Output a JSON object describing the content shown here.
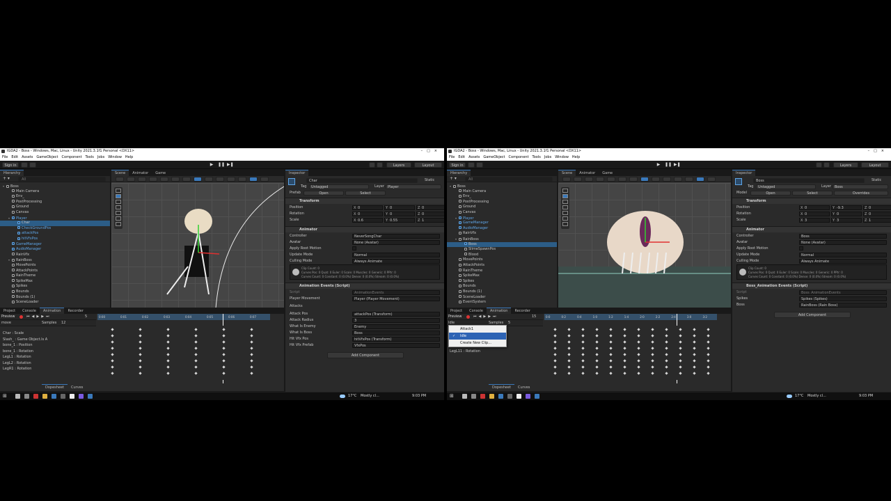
{
  "screens": [
    {
      "window_title": "IGDA2 - Boss - Windows, Mac, Linux - Unity 2021.3.1f1 Personal <DX11>",
      "menu": [
        "File",
        "Edit",
        "Assets",
        "GameObject",
        "Component",
        "Tools",
        "Jobs",
        "Window",
        "Help"
      ],
      "sign_in": "Sign in",
      "layers_label": "Layers",
      "layout_label": "Layout",
      "hierarchy": {
        "tab": "Hierarchy",
        "search_placeholder": "All",
        "items": [
          {
            "label": "Boss",
            "indent": 0,
            "selected": false,
            "blue": false
          },
          {
            "label": "Main Camera",
            "indent": 1,
            "selected": false,
            "blue": false
          },
          {
            "label": "Env_",
            "indent": 1,
            "selected": false,
            "blue": false
          },
          {
            "label": "PostProcessing",
            "indent": 1,
            "selected": false,
            "blue": false
          },
          {
            "label": "Ground",
            "indent": 1,
            "selected": false,
            "blue": false
          },
          {
            "label": "Canvas",
            "indent": 1,
            "selected": false,
            "blue": false
          },
          {
            "label": "Player",
            "indent": 1,
            "selected": false,
            "blue": true
          },
          {
            "label": "Char",
            "indent": 2,
            "selected": true,
            "blue": true
          },
          {
            "label": "CheckGroundPos",
            "indent": 2,
            "selected": false,
            "blue": true
          },
          {
            "label": "attackPos",
            "indent": 2,
            "selected": false,
            "blue": true
          },
          {
            "label": "hitVfxPos",
            "indent": 2,
            "selected": false,
            "blue": true
          },
          {
            "label": "GameManager",
            "indent": 1,
            "selected": false,
            "blue": true
          },
          {
            "label": "AudioManager",
            "indent": 1,
            "selected": false,
            "blue": true
          },
          {
            "label": "RainVfx",
            "indent": 1,
            "selected": false,
            "blue": false
          },
          {
            "label": "RainBoss",
            "indent": 1,
            "selected": false,
            "blue": false
          },
          {
            "label": "MovePoints",
            "indent": 1,
            "selected": false,
            "blue": false
          },
          {
            "label": "AttackPoints",
            "indent": 1,
            "selected": false,
            "blue": false
          },
          {
            "label": "RainTheme",
            "indent": 1,
            "selected": false,
            "blue": false
          },
          {
            "label": "SpikeMax",
            "indent": 1,
            "selected": false,
            "blue": false
          },
          {
            "label": "Spikes",
            "indent": 1,
            "selected": false,
            "blue": false
          },
          {
            "label": "Bounds",
            "indent": 1,
            "selected": false,
            "blue": false
          },
          {
            "label": "Bounds (1)",
            "indent": 1,
            "selected": false,
            "blue": false
          },
          {
            "label": "SceneLoader",
            "indent": 1,
            "selected": false,
            "blue": false
          }
        ]
      },
      "scene_tabs": [
        "Scene",
        "Animator",
        "Game"
      ],
      "inspector": {
        "tab": "Inspector",
        "object_name": "Char",
        "static_label": "Static",
        "tag_label": "Tag",
        "tag_value": "Untagged",
        "layer_label": "Layer",
        "layer_value": "Player",
        "prefab_label": "Prefab",
        "prefab_open": "Open",
        "prefab_select": "Select",
        "prefab_overrides": "",
        "transform_title": "Transform",
        "position_label": "Position",
        "rotation_label": "Rotation",
        "scale_label": "Scale",
        "position": [
          "0",
          "0",
          "0"
        ],
        "rotation": [
          "0",
          "0",
          "0"
        ],
        "scale": [
          "0.6",
          "0.55",
          "1"
        ],
        "animator_title": "Animator",
        "controller_label": "Controller",
        "controller_value": "NeverSongChar",
        "avatar_label": "Avatar",
        "avatar_value": "None (Avatar)",
        "apply_root_label": "Apply Root Motion",
        "update_mode_label": "Update Mode",
        "update_mode_value": "Normal",
        "culling_label": "Culling Mode",
        "culling_value": "Always Animate",
        "info_1": "Clip Count: 0",
        "info_2": "Curves Pos: 0 Quat: 0 Euler: 0 Scale: 0 Muscles: 0 Generic: 0 PPtr: 0",
        "info_3": "Curves Count: 0 Constant: 0 (0.0%) Dense: 0 (0.0%) Stream: 0 (0.0%)",
        "script_title": "Animation Events (Script)",
        "script_fields": [
          {
            "label": "Script",
            "value": "AnimationEvents"
          },
          {
            "label": "Player Movement",
            "value": "Player (Player Movement)"
          },
          {
            "label": "Attacks",
            "value": ""
          },
          {
            "label": "Attack Pos",
            "value": "attackPos (Transform)"
          },
          {
            "label": "Attack Radius",
            "value": "3"
          },
          {
            "label": "What Is Enemy",
            "value": "Enemy"
          },
          {
            "label": "What Is Boss",
            "value": "Boss"
          },
          {
            "label": "Hit Vfx Pos",
            "value": "hitVfxPos (Transform)"
          },
          {
            "label": "Hit Vfx Prefab",
            "value": "VfxPos"
          }
        ],
        "add_component": "Add Component"
      },
      "animation": {
        "tabs": [
          "Project",
          "Console",
          "Animation",
          "Recorder"
        ],
        "preview_label": "Preview",
        "frame_value": "5",
        "clip_name": "move",
        "samples_label": "Samples",
        "samples_value": "12",
        "ruler": [
          "0:00",
          "0:01",
          "0:02",
          "0:03",
          "0:04",
          "0:05",
          "0:06",
          "0:07"
        ],
        "properties": [
          "Char : Scale",
          "Slash_ : Game Object.Is A",
          "bone_1 : Position",
          "bone_1 : Rotation",
          "LegL1 : Rotation",
          "LegL2 : Rotation",
          "LegR1 : Rotation"
        ],
        "bottom_tabs": [
          "Dopesheet",
          "Curves"
        ]
      },
      "dropdown": null,
      "taskbar": {
        "weather": "17°C",
        "weather_text": "Mostly cl...",
        "time": "9:03 PM"
      }
    },
    {
      "window_title": "IGDA2 - Boss - Windows, Mac, Linux - Unity 2021.3.1f1 Personal <DX11>",
      "menu": [
        "File",
        "Edit",
        "Assets",
        "GameObject",
        "Component",
        "Tools",
        "Jobs",
        "Window",
        "Help"
      ],
      "sign_in": "Sign in",
      "layers_label": "Layers",
      "layout_label": "Layout",
      "hierarchy": {
        "tab": "Hierarchy",
        "search_placeholder": "All",
        "items": [
          {
            "label": "Boss",
            "indent": 0,
            "selected": false,
            "blue": false
          },
          {
            "label": "Main Camera",
            "indent": 1,
            "selected": false,
            "blue": false
          },
          {
            "label": "Env_",
            "indent": 1,
            "selected": false,
            "blue": false
          },
          {
            "label": "PostProcessing",
            "indent": 1,
            "selected": false,
            "blue": false
          },
          {
            "label": "Ground",
            "indent": 1,
            "selected": false,
            "blue": false
          },
          {
            "label": "Canvas",
            "indent": 1,
            "selected": false,
            "blue": false
          },
          {
            "label": "Player",
            "indent": 1,
            "selected": false,
            "blue": true
          },
          {
            "label": "GameManager",
            "indent": 1,
            "selected": false,
            "blue": true
          },
          {
            "label": "AudioManager",
            "indent": 1,
            "selected": false,
            "blue": true
          },
          {
            "label": "RainVfx",
            "indent": 1,
            "selected": false,
            "blue": false
          },
          {
            "label": "RainBoss",
            "indent": 1,
            "selected": false,
            "blue": false
          },
          {
            "label": "Boss",
            "indent": 2,
            "selected": true,
            "blue": true
          },
          {
            "label": "SlimeSpawnPos",
            "indent": 2,
            "selected": false,
            "blue": false
          },
          {
            "label": "Blood",
            "indent": 2,
            "selected": false,
            "blue": false
          },
          {
            "label": "MovePoints",
            "indent": 1,
            "selected": false,
            "blue": false
          },
          {
            "label": "AttackPoints",
            "indent": 1,
            "selected": false,
            "blue": false
          },
          {
            "label": "RainTheme",
            "indent": 1,
            "selected": false,
            "blue": false
          },
          {
            "label": "SpikeMax",
            "indent": 1,
            "selected": false,
            "blue": false
          },
          {
            "label": "Spikes",
            "indent": 1,
            "selected": false,
            "blue": false
          },
          {
            "label": "Bounds",
            "indent": 1,
            "selected": false,
            "blue": false
          },
          {
            "label": "Bounds (1)",
            "indent": 1,
            "selected": false,
            "blue": false
          },
          {
            "label": "SceneLoader",
            "indent": 1,
            "selected": false,
            "blue": false
          },
          {
            "label": "EventSystem",
            "indent": 1,
            "selected": false,
            "blue": false
          }
        ]
      },
      "scene_tabs": [
        "Scene",
        "Animator",
        "Game"
      ],
      "inspector": {
        "tab": "Inspector",
        "object_name": "Boss",
        "static_label": "Static",
        "tag_label": "Tag",
        "tag_value": "Untagged",
        "layer_label": "Layer",
        "layer_value": "Boss",
        "prefab_label": "Model",
        "prefab_open": "Open",
        "prefab_select": "Select",
        "prefab_overrides": "Overrides",
        "transform_title": "Transform",
        "position_label": "Position",
        "rotation_label": "Rotation",
        "scale_label": "Scale",
        "position": [
          "0",
          "-9.3",
          "0"
        ],
        "rotation": [
          "0",
          "0",
          "0"
        ],
        "scale": [
          "3",
          "3",
          "1"
        ],
        "animator_title": "Animator",
        "controller_label": "Controller",
        "controller_value": "Boss",
        "avatar_label": "Avatar",
        "avatar_value": "None (Avatar)",
        "apply_root_label": "Apply Root Motion",
        "update_mode_label": "Update Mode",
        "update_mode_value": "Normal",
        "culling_label": "Culling Mode",
        "culling_value": "Always Animate",
        "info_1": "Clip Count: 0",
        "info_2": "Curves Pos: 0 Quat: 0 Euler: 0 Scale: 0 Muscles: 0 Generic: 0 PPtr: 0",
        "info_3": "Curves Count: 0 Constant: 0 (0.0%) Dense: 0 (0.0%) Stream: 0 (0.0%)",
        "script_title": "Boss_Animation Events (Script)",
        "script_fields": [
          {
            "label": "Script",
            "value": "Boss_AnimationEvents"
          },
          {
            "label": "Spikes",
            "value": "Spikes (Spikes)"
          },
          {
            "label": "Boss",
            "value": "RainBoss (Rain Boss)"
          }
        ],
        "add_component": "Add Component"
      },
      "animation": {
        "tabs": [
          "Project",
          "Console",
          "Animation",
          "Recorder"
        ],
        "preview_label": "Preview",
        "frame_value": "15",
        "clip_name": "Idle",
        "samples_label": "Samples",
        "samples_value": "5",
        "ruler": [
          "0:0",
          "0:2",
          "0:4",
          "1:0",
          "1:2",
          "1:4",
          "2:0",
          "2:2",
          "2:4",
          "3:0",
          "3:2"
        ],
        "properties": [
          "LegL1 : Position",
          "LegL11 : Rotation",
          "LegL11 : Position",
          "LegL11 : Rotation"
        ],
        "bottom_tabs": [
          "Dopesheet",
          "Curves"
        ]
      },
      "dropdown": {
        "items": [
          {
            "label": "Attack1",
            "checked": false,
            "highlighted": false
          },
          {
            "label": "Idle",
            "checked": true,
            "highlighted": true
          },
          {
            "label": "Create New Clip...",
            "checked": false,
            "highlighted": false
          }
        ]
      },
      "taskbar": {
        "weather": "17°C",
        "weather_text": "Mostly cl...",
        "time": "9:03 PM"
      }
    }
  ],
  "colors": {
    "accent": "#3a79bb",
    "selection": "#2c5d87",
    "prefab_blue": "#5fa6e8",
    "panel": "#2a2a2a",
    "scene_bg": "#454545"
  }
}
